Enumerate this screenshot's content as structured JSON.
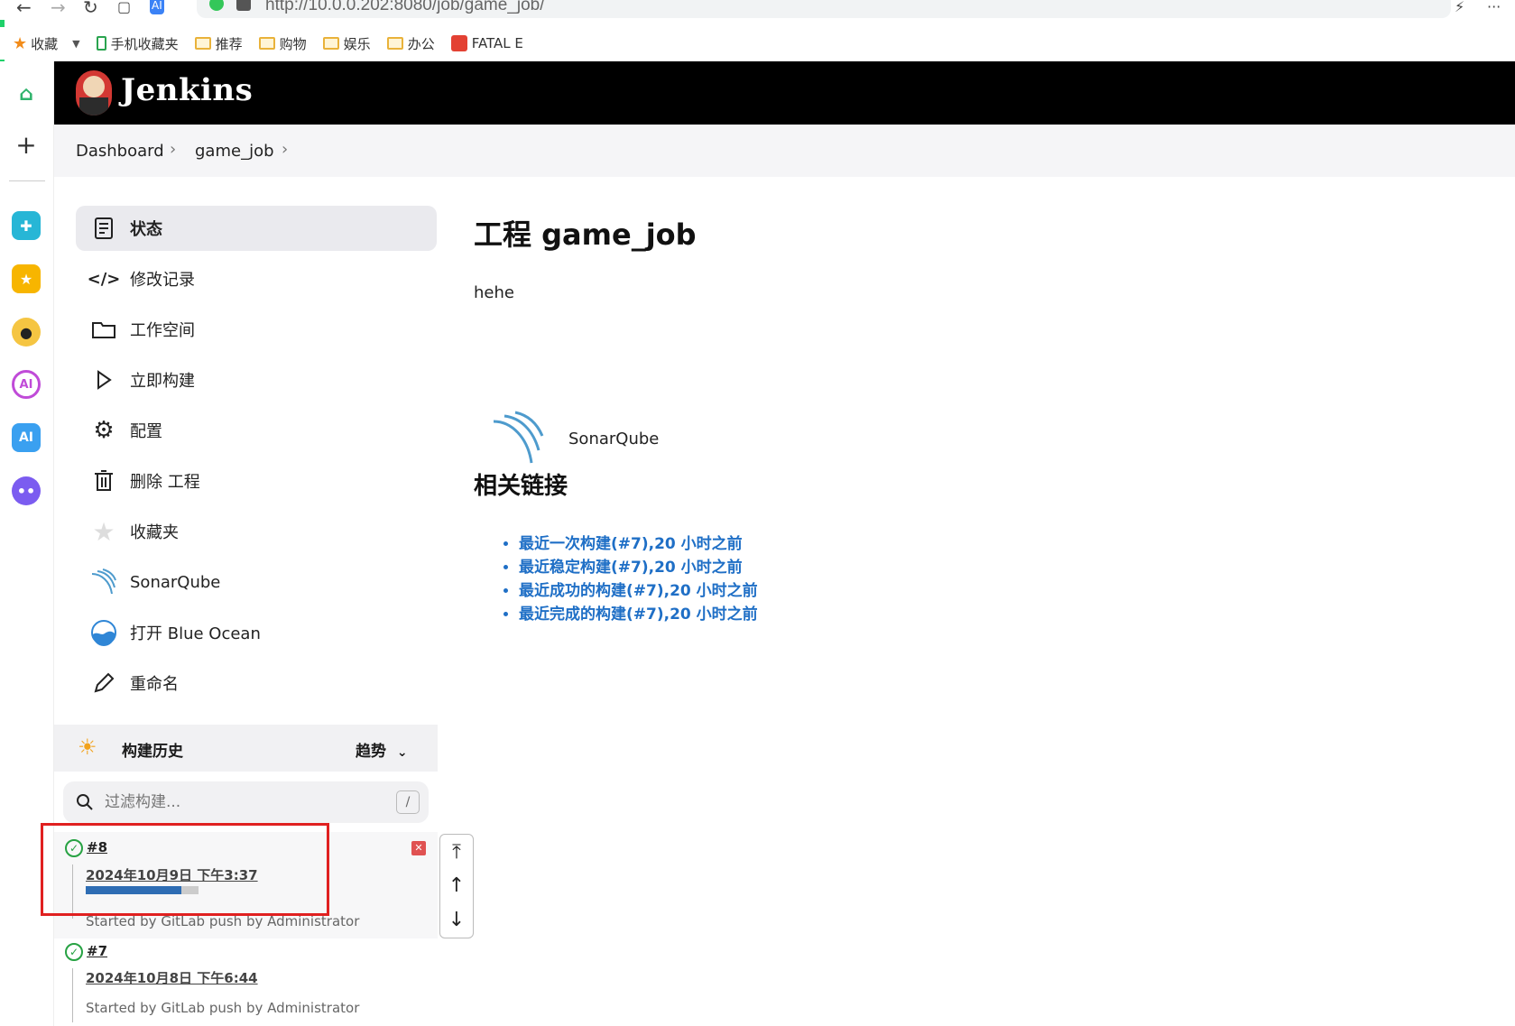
{
  "browser": {
    "url": "http://10.0.0.202:8080/job/game_job/",
    "bookmarks": [
      {
        "label": "收藏",
        "kind": "star"
      },
      {
        "label": "手机收藏夹",
        "kind": "phone"
      },
      {
        "label": "推荐",
        "kind": "folder"
      },
      {
        "label": "购物",
        "kind": "folder"
      },
      {
        "label": "娱乐",
        "kind": "folder"
      },
      {
        "label": "办公",
        "kind": "folder"
      },
      {
        "label": "FATAL E",
        "kind": "red"
      }
    ]
  },
  "header": {
    "title": "Jenkins"
  },
  "breadcrumb": {
    "items": [
      "Dashboard",
      "game_job"
    ]
  },
  "tasks": [
    {
      "label": "状态",
      "icon": "status-icon",
      "active": true
    },
    {
      "label": "修改记录",
      "icon": "code-icon"
    },
    {
      "label": "工作空间",
      "icon": "folder-icon"
    },
    {
      "label": "立即构建",
      "icon": "play-icon"
    },
    {
      "label": "配置",
      "icon": "gear-icon"
    },
    {
      "label": "删除 工程",
      "icon": "trash-icon"
    },
    {
      "label": "收藏夹",
      "icon": "star-icon"
    },
    {
      "label": "SonarQube",
      "icon": "sonarqube-icon"
    },
    {
      "label": "打开 Blue Ocean",
      "icon": "blue-ocean-icon"
    },
    {
      "label": "重命名",
      "icon": "pencil-icon"
    }
  ],
  "build_history": {
    "title": "构建历史",
    "trend_label": "趋势",
    "search_placeholder": "过滤构建...",
    "shortcut": "/",
    "builds": [
      {
        "number": "#8",
        "date": "2024年10月9日 下午3:37",
        "started_by": "Started by GitLab push by Administrator",
        "progress": 0.85,
        "running": true
      },
      {
        "number": "#7",
        "date": "2024年10月8日 下午6:44",
        "started_by": "Started by GitLab push by Administrator",
        "running": false
      }
    ]
  },
  "main": {
    "title": "工程 game_job",
    "description": "hehe",
    "sonar_label": "SonarQube",
    "related_title": "相关链接",
    "links": [
      "最近一次构建(#7),20 小时之前",
      "最近稳定构建(#7),20 小时之前",
      "最近成功的构建(#7),20 小时之前",
      "最近完成的构建(#7),20 小时之前"
    ]
  }
}
